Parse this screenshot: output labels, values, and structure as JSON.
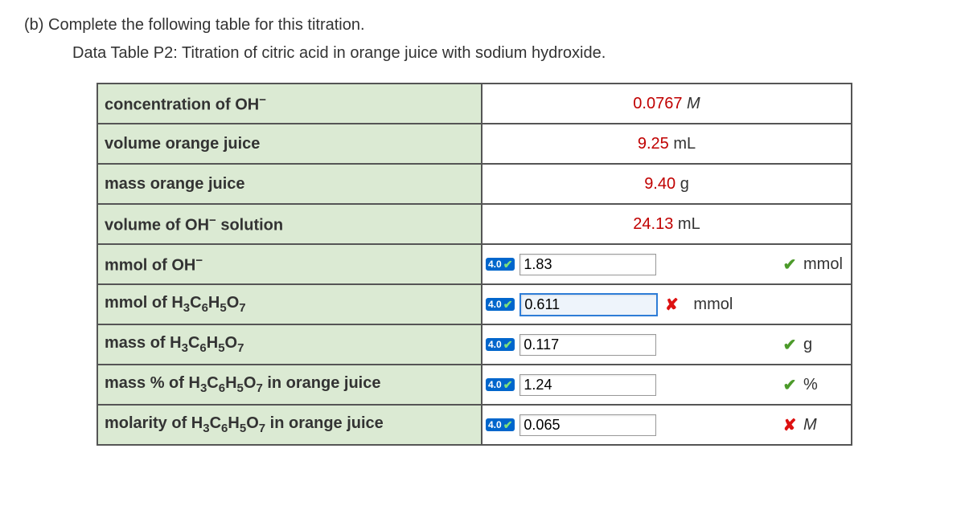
{
  "header": {
    "part_label": "(b)",
    "prompt": "Complete the following table for this titration.",
    "subtitle": "Data Table P2: Titration of citric acid in orange juice with sodium hydroxide."
  },
  "badge": {
    "text": "4.0"
  },
  "rows_given": [
    {
      "label_html": "concentration of OH<sup>−</sup>",
      "value": "0.0767",
      "unit_html": "<span class='em'>M</span>"
    },
    {
      "label_html": "volume orange juice",
      "value": "9.25",
      "unit_html": "mL"
    },
    {
      "label_html": "mass orange juice",
      "value": "9.40",
      "unit_html": "g"
    },
    {
      "label_html": "volume of OH<sup>−</sup> solution",
      "value": "24.13",
      "unit_html": "mL"
    }
  ],
  "rows_input": [
    {
      "id": "mmol-oh",
      "label_html": "mmol of OH<sup>−</sup>",
      "value": "1.83",
      "unit": "mmol",
      "status": "correct",
      "unit_after_mark": true,
      "selected": false
    },
    {
      "id": "mmol-citric",
      "label_html": "mmol of H<sub>3</sub>C<sub>6</sub>H<sub>5</sub>O<sub>7</sub>",
      "value": "0.611",
      "unit": "mmol",
      "status": "wrong",
      "unit_after_mark": true,
      "selected": true
    },
    {
      "id": "mass-citric",
      "label_html": "mass of H<sub>3</sub>C<sub>6</sub>H<sub>5</sub>O<sub>7</sub>",
      "value": "0.117",
      "unit": "g",
      "status": "correct",
      "unit_after_mark": true,
      "selected": false
    },
    {
      "id": "masspct-citric",
      "label_html": "mass % of H<sub>3</sub>C<sub>6</sub>H<sub>5</sub>O<sub>7</sub> in orange juice",
      "value": "1.24",
      "unit": "%",
      "status": "correct",
      "unit_after_mark": true,
      "selected": false
    },
    {
      "id": "molarity-citric",
      "label_html": "molarity of H<sub>3</sub>C<sub>6</sub>H<sub>5</sub>O<sub>7</sub> in orange juice",
      "value": "0.065",
      "unit_html": "<span class='em'>M</span>",
      "unit": "M",
      "status": "wrong",
      "unit_after_mark": true,
      "selected": false
    }
  ]
}
